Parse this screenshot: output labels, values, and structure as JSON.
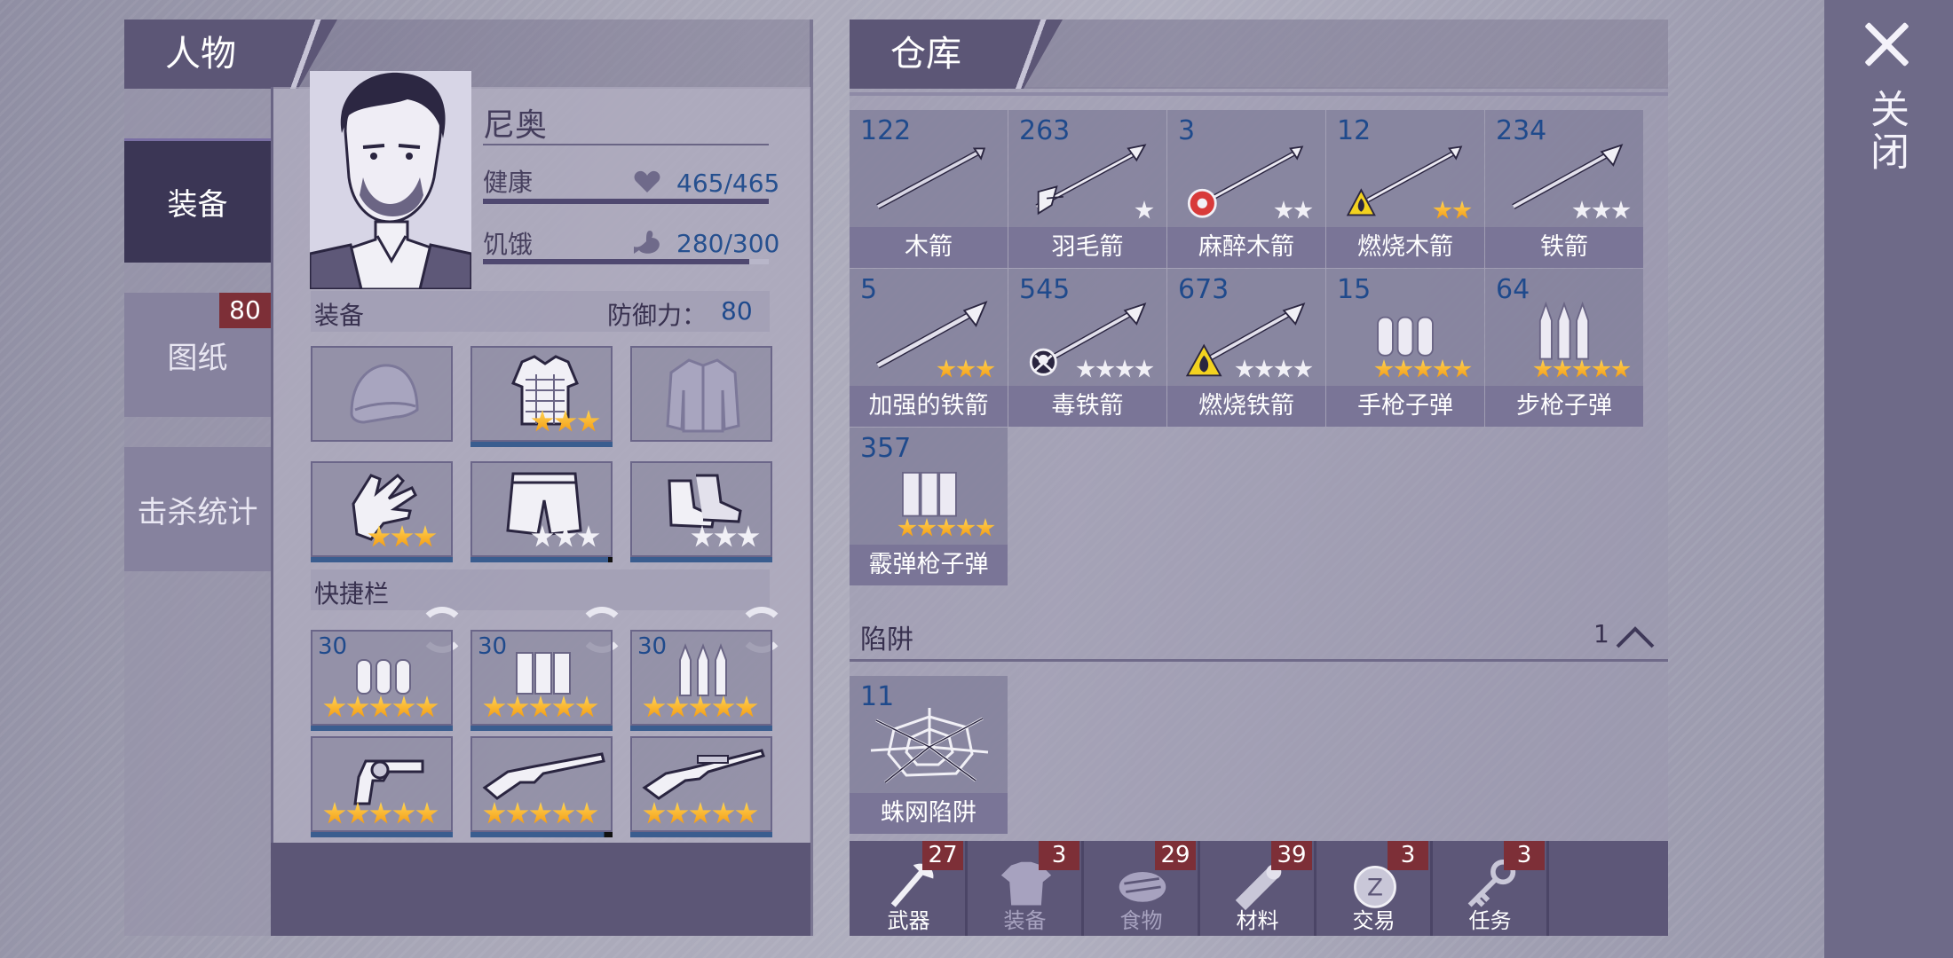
{
  "character_panel": {
    "title": "人物",
    "name": "尼奥",
    "side_tabs": [
      {
        "label": "装备",
        "active": true
      },
      {
        "label": "图纸",
        "badge": "80"
      },
      {
        "label": "击杀统计"
      }
    ],
    "health": {
      "label": "健康",
      "value": "465/465",
      "fraction": 1.0
    },
    "hunger": {
      "label": "饥饿",
      "value": "280/300",
      "fraction": 0.933
    },
    "equipment": {
      "label": "装备",
      "defense_label": "防御力：",
      "defense_value": "80",
      "slots": [
        {
          "icon": "helmet-icon",
          "stars": 0
        },
        {
          "icon": "armor-vest-icon",
          "stars": 3,
          "star_color": "gold"
        },
        {
          "icon": "jacket-icon",
          "stars": 0
        },
        {
          "icon": "gloves-icon",
          "stars": 3,
          "star_color": "gold"
        },
        {
          "icon": "shorts-icon",
          "stars": 3,
          "star_color": "white",
          "durability": 0.97
        },
        {
          "icon": "boots-icon",
          "stars": 3,
          "star_color": "white"
        }
      ]
    },
    "quickbar": {
      "label": "快捷栏",
      "ammo": [
        {
          "qty": "30",
          "icon": "pistol-ammo-icon",
          "stars": 5
        },
        {
          "qty": "30",
          "icon": "shotgun-ammo-icon",
          "stars": 5
        },
        {
          "qty": "30",
          "icon": "rifle-ammo-icon",
          "stars": 5
        }
      ],
      "weapons": [
        {
          "icon": "revolver-icon",
          "stars": 5
        },
        {
          "icon": "shotgun-icon",
          "stars": 5,
          "durability": 0.94
        },
        {
          "icon": "rifle-icon",
          "stars": 5
        }
      ]
    }
  },
  "warehouse": {
    "title": "仓库",
    "items": [
      {
        "qty": "122",
        "name": "木箭",
        "icon": "wooden-arrow-icon",
        "stars": 0
      },
      {
        "qty": "263",
        "name": "羽毛箭",
        "icon": "feather-arrow-icon",
        "stars": 1,
        "star_color": "white"
      },
      {
        "qty": "3",
        "name": "麻醉木箭",
        "icon": "tranquilizer-arrow-icon",
        "stars": 2,
        "star_color": "white"
      },
      {
        "qty": "12",
        "name": "燃烧木箭",
        "icon": "fire-arrow-icon",
        "stars": 2,
        "star_color": "gold"
      },
      {
        "qty": "234",
        "name": "铁箭",
        "icon": "iron-arrow-icon",
        "stars": 3,
        "star_color": "white"
      },
      {
        "qty": "5",
        "name": "加强的铁箭",
        "icon": "reinforced-iron-arrow-icon",
        "stars": 3,
        "star_color": "gold"
      },
      {
        "qty": "545",
        "name": "毒铁箭",
        "icon": "poison-iron-arrow-icon",
        "stars": 4,
        "star_color": "white"
      },
      {
        "qty": "673",
        "name": "燃烧铁箭",
        "icon": "fire-iron-arrow-icon",
        "stars": 4,
        "star_color": "white"
      },
      {
        "qty": "15",
        "name": "手枪子弹",
        "icon": "pistol-ammo-icon",
        "stars": 5,
        "star_color": "gold"
      },
      {
        "qty": "64",
        "name": "步枪子弹",
        "icon": "rifle-ammo-icon",
        "stars": 5,
        "star_color": "gold"
      },
      {
        "qty": "357",
        "name": "霰弹枪子弹",
        "icon": "shotgun-ammo-icon",
        "stars": 5,
        "star_color": "gold"
      }
    ],
    "trap_section": {
      "label": "陷阱",
      "count": "1"
    },
    "traps": [
      {
        "qty": "11",
        "name": "蛛网陷阱",
        "icon": "spiderweb-trap-icon"
      }
    ],
    "categories": [
      {
        "label": "武器",
        "badge": "27",
        "icon": "axe-icon",
        "active": true
      },
      {
        "label": "装备",
        "badge": "3",
        "icon": "shirt-icon"
      },
      {
        "label": "食物",
        "badge": "29",
        "icon": "food-icon"
      },
      {
        "label": "材料",
        "badge": "39",
        "icon": "log-icon"
      },
      {
        "label": "交易",
        "badge": "3",
        "icon": "coin-icon"
      },
      {
        "label": "任务",
        "badge": "3",
        "icon": "key-icon"
      }
    ]
  },
  "close": {
    "label": "关闭"
  },
  "colors": {
    "star_gold": "#f5a623",
    "qty_blue": "#1f4a8c",
    "badge_red": "#7d2f37",
    "panel_dark": "#5c5676"
  }
}
